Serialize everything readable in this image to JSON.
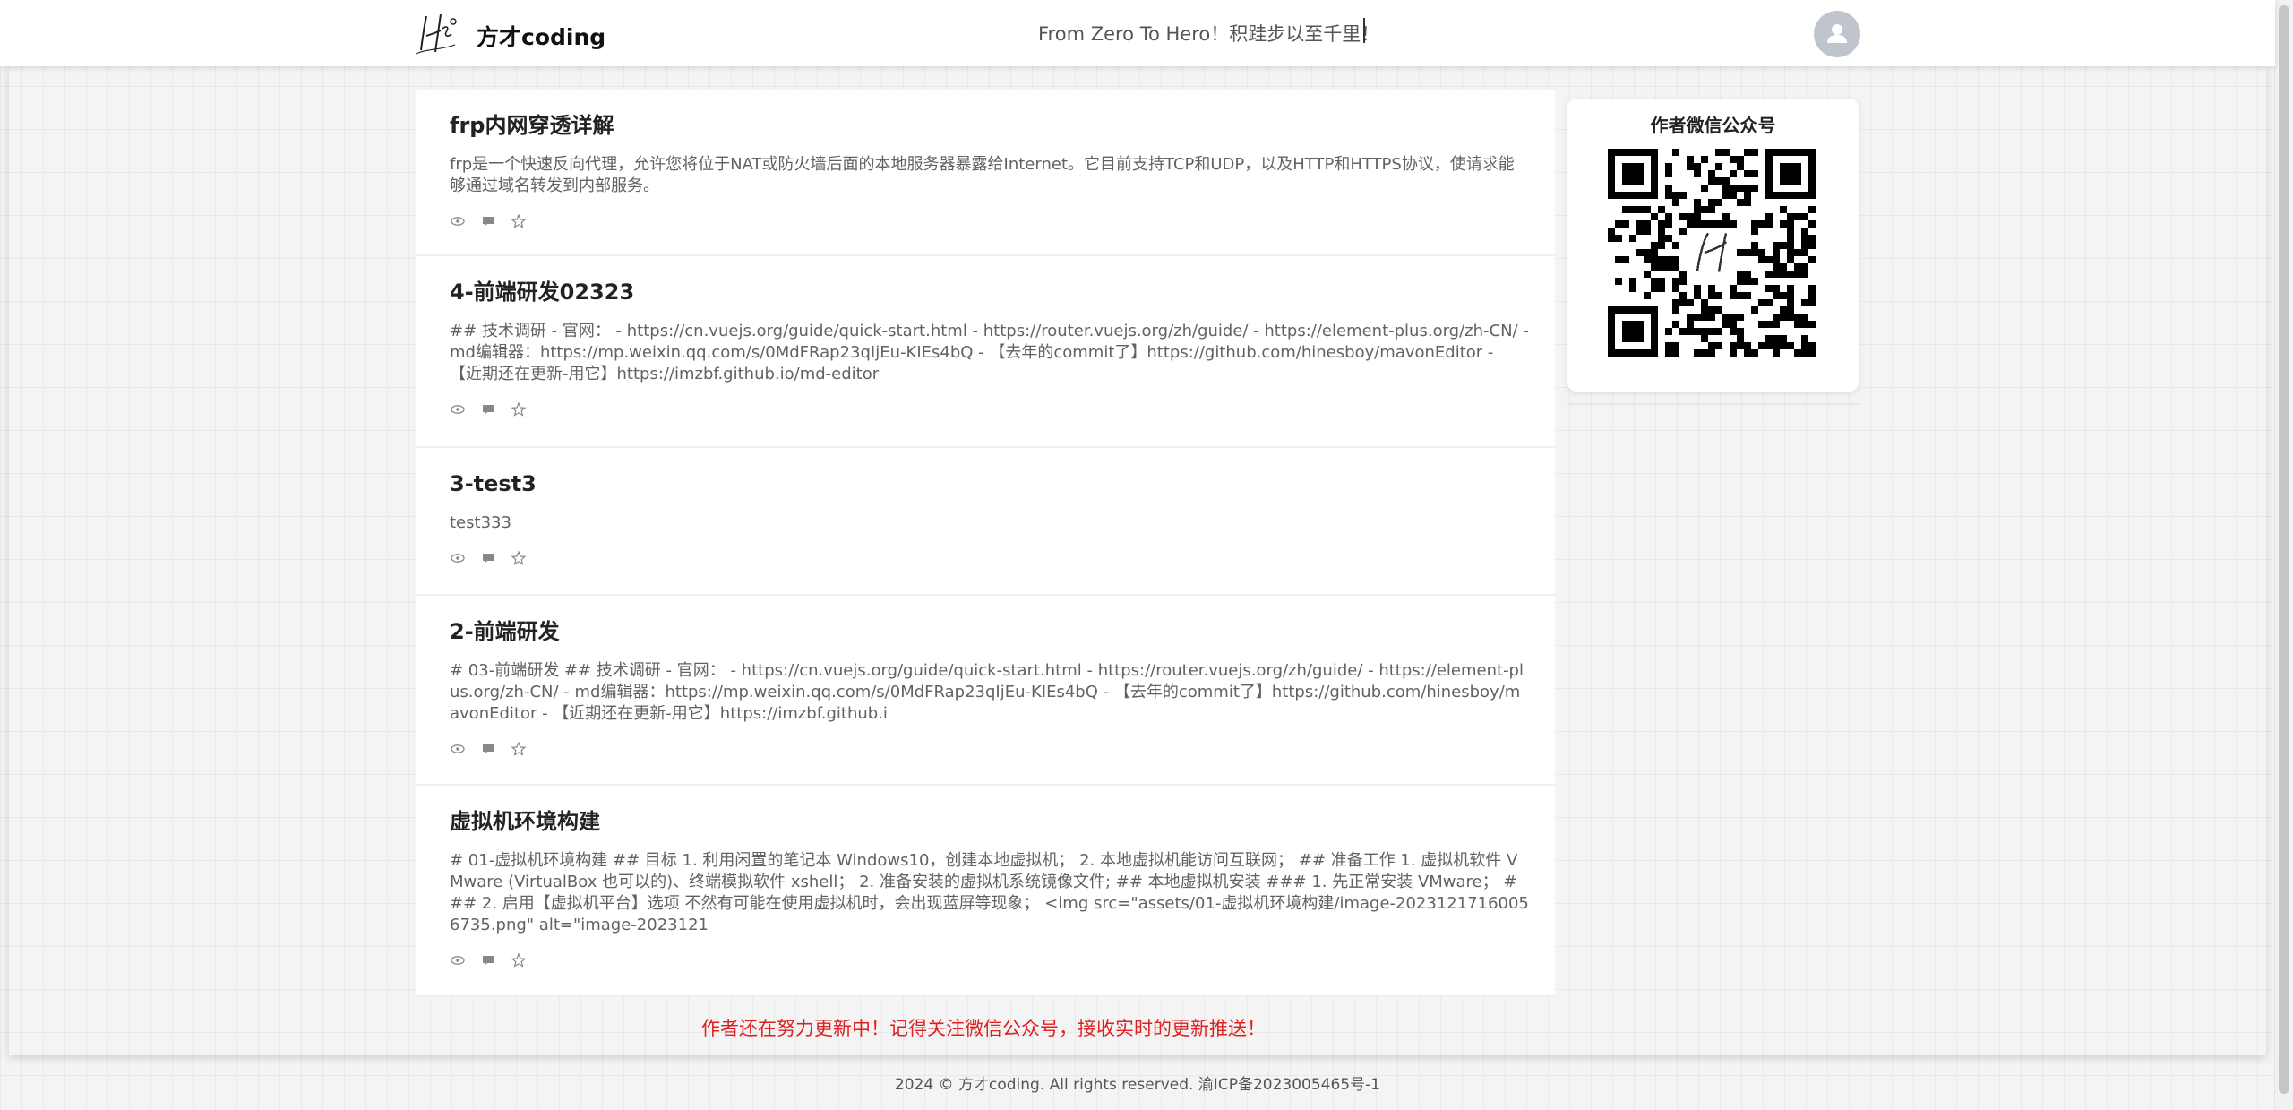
{
  "header": {
    "site_name": "方才coding",
    "slogan": "From Zero To Hero！积跬步以至千里！",
    "logo_icon": "hero-signature-logo",
    "avatar_icon": "user-avatar-icon"
  },
  "articles": [
    {
      "title": "frp内网穿透详解",
      "summary": "frp是一个快速反向代理，允许您将位于NAT或防火墙后面的本地服务器暴露给Internet。它目前支持TCP和UDP，以及HTTP和HTTPS协议，使请求能够通过域名转发到内部服务。"
    },
    {
      "title": "4-前端研发02323",
      "summary": "## 技术调研 - 官网： - https://cn.vuejs.org/guide/quick-start.html - https://router.vuejs.org/zh/guide/ - https://element-plus.org/zh-CN/ - md编辑器：https://mp.weixin.qq.com/s/0MdFRap23qIjEu-KIEs4bQ - 【去年的commit了】https://github.com/hinesboy/mavonEditor - 【近期还在更新-用它】https://imzbf.github.io/md-editor"
    },
    {
      "title": "3-test3",
      "summary": "test333"
    },
    {
      "title": "2-前端研发",
      "summary": "# 03-前端研发 ## 技术调研 - 官网： - https://cn.vuejs.org/guide/quick-start.html - https://router.vuejs.org/zh/guide/ - https://element-plus.org/zh-CN/ - md编辑器：https://mp.weixin.qq.com/s/0MdFRap23qIjEu-KIEs4bQ - 【去年的commit了】https://github.com/hinesboy/mavonEditor - 【近期还在更新-用它】https://imzbf.github.i"
    },
    {
      "title": "虚拟机环境构建",
      "summary": "# 01-虚拟机环境构建 ## 目标 1. 利用闲置的笔记本 Windows10，创建本地虚拟机； 2. 本地虚拟机能访问互联网； ## 准备工作 1. 虚拟机软件 VMware (VirtualBox 也可以的)、终端模拟软件 xshell； 2. 准备安装的虚拟机系统镜像文件; ## 本地虚拟机安装 ### 1. 先正常安装 VMware； ### 2. 启用【虚拟机平台】选项 不然有可能在使用虚拟机时，会出现蓝屏等现象； <img src=\"assets/01-虚拟机环境构建/image-20231217160056735.png\" alt=\"image-2023121"
    }
  ],
  "meta_icons": [
    "eye-icon",
    "comment-icon",
    "star-icon"
  ],
  "sidebar": {
    "wechat_title": "作者微信公众号"
  },
  "notice": "作者还在努力更新中！记得关注微信公众号，接收实时的更新推送！",
  "footer": "2024 © 方才coding. All rights reserved. 渝ICP备2023005465号-1",
  "colors": {
    "notice": "#e02020",
    "background": "#f4f4f4"
  }
}
